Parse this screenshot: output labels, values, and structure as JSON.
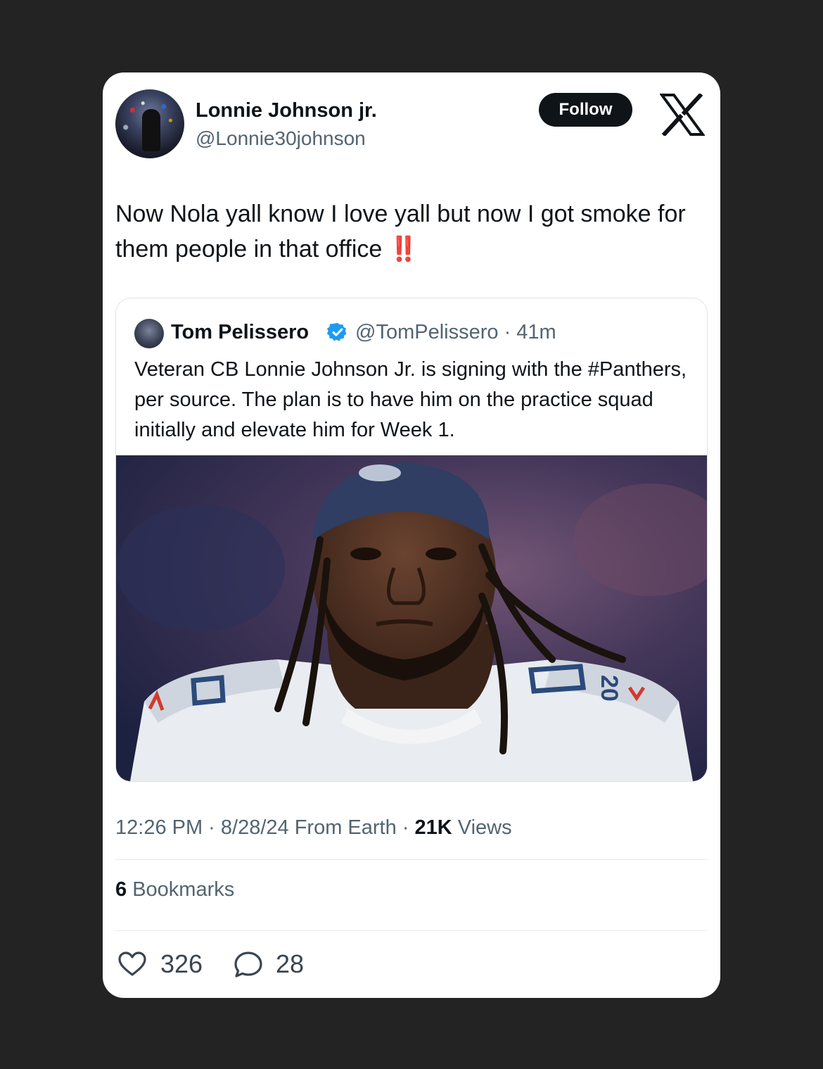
{
  "author": {
    "name": "Lonnie Johnson jr.",
    "handle": "@Lonnie30johnson",
    "follow_label": "Follow"
  },
  "platform_icon": "x-logo-icon",
  "tweet": {
    "text": "Now Nola yall know I love yall but now I got smoke for them people in that office",
    "emoji": "‼️"
  },
  "quoted": {
    "name": "Tom Pelissero",
    "verified_icon": "verified-badge-icon",
    "handle": "@TomPelissero",
    "time": "· 41m",
    "text": "Veteran CB Lonnie Johnson Jr. is signing with the #Panthers, per source. The plan is to have him on the practice squad initially and elevate him for Week 1.",
    "jersey_number": "20"
  },
  "meta": {
    "time": "12:26 PM · 8/28/24 From Earth · ",
    "views_count": "21K",
    "views_label": " Views"
  },
  "bookmarks": {
    "count": "6",
    "label": " Bookmarks"
  },
  "actions": {
    "likes": "326",
    "replies": "28"
  },
  "colors": {
    "background": "#232323",
    "card": "#ffffff",
    "verified": "#1d9bf0",
    "emphasis": "#e0242e"
  }
}
